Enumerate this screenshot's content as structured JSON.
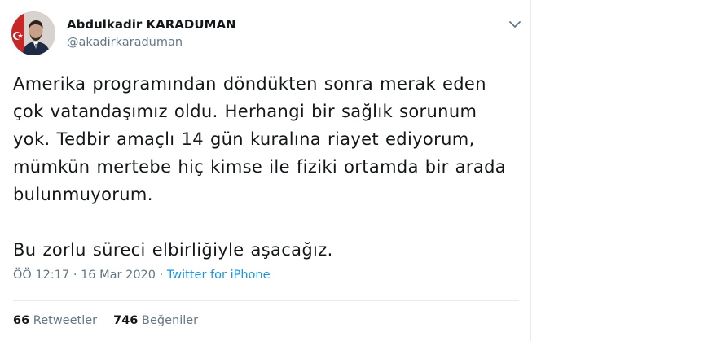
{
  "author": {
    "name": "Abdulkadir KARADUMAN",
    "handle": "@akadirkaraduman"
  },
  "tweet": {
    "text": "Amerika programından döndükten sonra merak eden\nçok vatandaşımız oldu. Herhangi bir sağlık sorunum\nyok. Tedbir amaçlı 14 gün kuralına riayet ediyorum,\nmümkün mertebe hiç kimse ile fiziki ortamda bir arada\nbulunmuyorum.\n\nBu zorlu süreci elbirliğiyle aşacağız.",
    "time": "ÖÖ 12:17",
    "separator": " · ",
    "date": "16 Mar 2020",
    "source": "Twitter for iPhone"
  },
  "stats": {
    "retweets_count": "66",
    "retweets_label": "Retweetler",
    "likes_count": "746",
    "likes_label": "Beğeniler"
  },
  "icons": {
    "caret": "chevron-down-icon"
  },
  "colors": {
    "link": "#1b95e0",
    "secondary_text": "#657786",
    "primary_text": "#14171a"
  }
}
